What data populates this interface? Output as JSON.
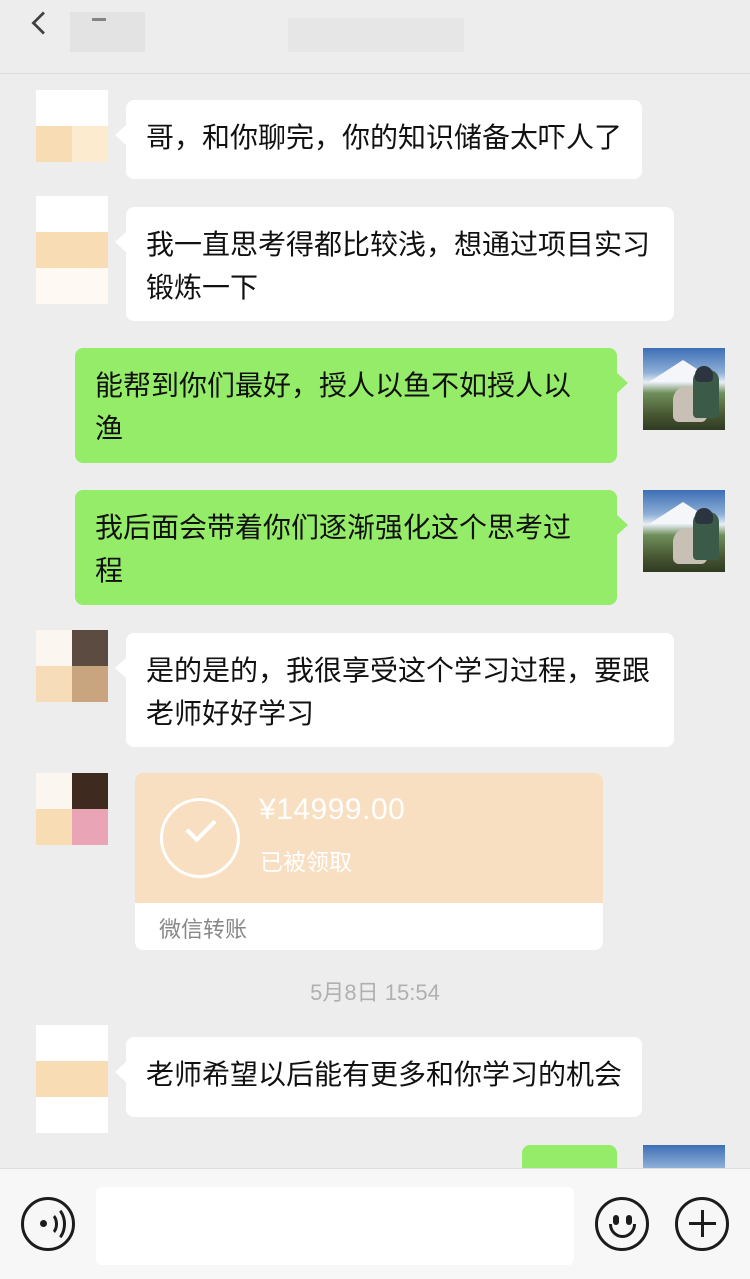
{
  "header": {
    "title": ""
  },
  "messages": [
    {
      "side": "left",
      "text": "哥，和你聊完，你的知识储备太吓人了"
    },
    {
      "side": "left",
      "text": "我一直思考得都比较浅，想通过项目实习锻炼一下"
    },
    {
      "side": "right",
      "text": "能帮到你们最好，授人以鱼不如授人以渔"
    },
    {
      "side": "right",
      "text": "我后面会带着你们逐渐强化这个思考过程"
    },
    {
      "side": "left",
      "text": "是的是的，我很享受这个学习过程，要跟老师好好学习"
    },
    {
      "side": "left",
      "text": "老师希望以后能有更多和你学习的机会"
    }
  ],
  "transfer": {
    "amount": "¥14999.00",
    "status": "已被领取",
    "label": "微信转账",
    "color": "#f9dfc1"
  },
  "timestamp": "5月8日 15:54",
  "colors": {
    "background": "#ededed",
    "self_bubble": "#95ec69",
    "other_bubble": "#ffffff"
  },
  "icons": {
    "voice": "voice-icon",
    "emoji": "emoji-icon",
    "plus": "plus-icon",
    "back": "back-arrow-icon"
  }
}
